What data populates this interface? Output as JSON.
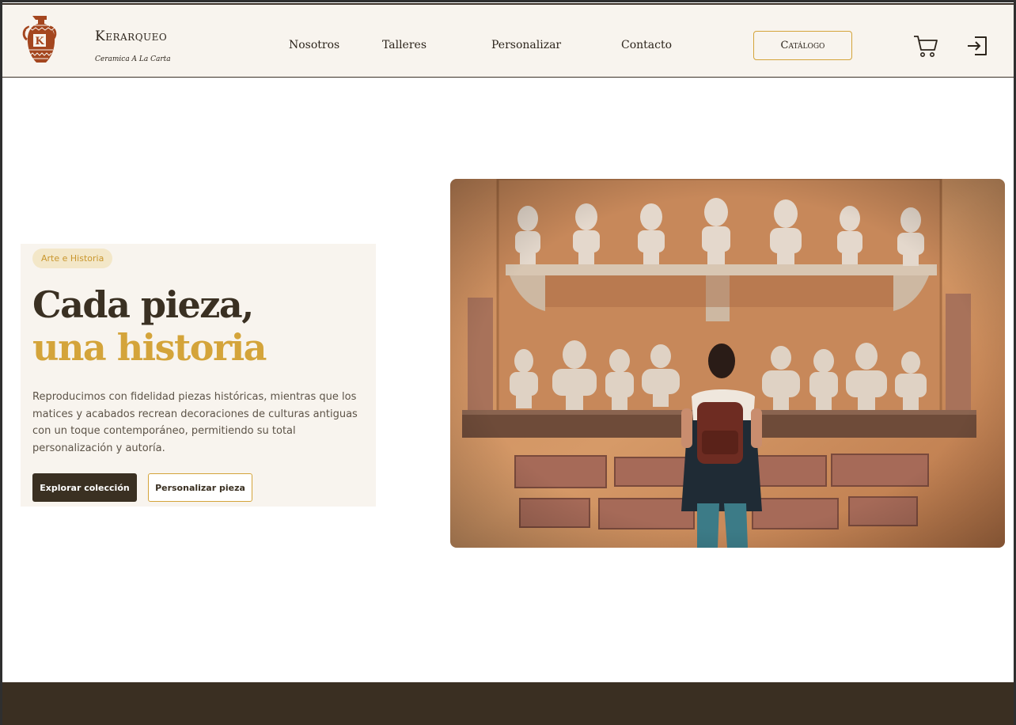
{
  "header": {
    "brand_name": "Kerarqueo",
    "tagline": "Ceramica A La Carta",
    "logo_letter": "K",
    "nav": [
      {
        "label": "Nosotros"
      },
      {
        "label": "Talleres"
      },
      {
        "label": "Personalizar"
      },
      {
        "label": "Contacto"
      }
    ],
    "catalog_label": "Catálogo",
    "icons": {
      "cart": "cart-icon",
      "login": "login-icon",
      "logo": "amphora-logo"
    }
  },
  "hero": {
    "badge": "Arte e Historia",
    "title_line1": "Cada pieza,",
    "title_line2": "una historia",
    "description": "Reproducimos con fidelidad piezas históricas, mientras que los matices y acabados recrean decoraciones de culturas antiguas con un toque contemporáneo, permitiendo su total personalización y autoría.",
    "primary_button": "Explorar colección",
    "secondary_button": "Personalizar pieza"
  },
  "colors": {
    "accent_gold": "#d4a43a",
    "dark_brown": "#3a3022",
    "cream": "#f8f4ee",
    "terracotta": "#a4461f"
  }
}
